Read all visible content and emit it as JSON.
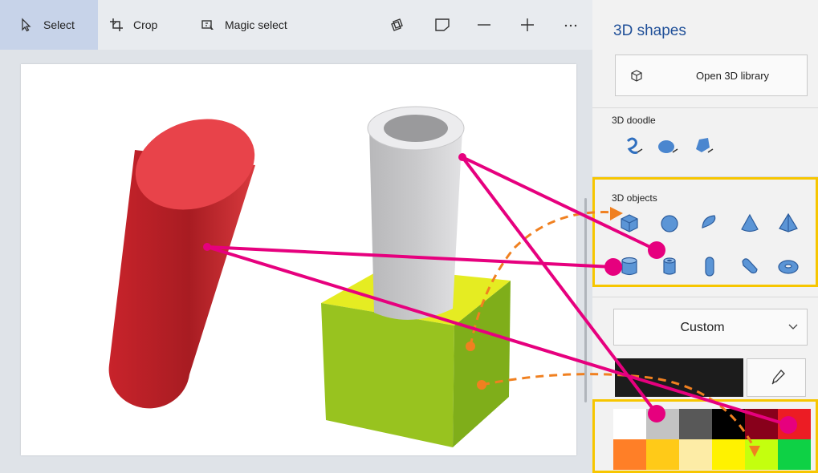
{
  "toolbar": {
    "select_label": "Select",
    "crop_label": "Crop",
    "magic_select_label": "Magic select",
    "icons": [
      "select-arrow-icon",
      "crop-icon",
      "magic-select-icon",
      "view-3d-icon",
      "sticker-icon",
      "zoom-out-icon",
      "zoom-in-icon",
      "more-icon"
    ]
  },
  "panel": {
    "title": "3D shapes",
    "library_button": "Open 3D library",
    "doodle_label": "3D doodle",
    "objects_label": "3D objects",
    "dropdown_value": "Custom"
  },
  "palette": [
    "#ffffff",
    "#c3c3c3",
    "#585858",
    "#000000",
    "#88001b",
    "#ec1c24",
    "#ff7f27",
    "#ffca18",
    "#fdeca6",
    "#fff200",
    "#c4ff0e",
    "#0ed145"
  ],
  "colors": {
    "accent": "#1f4f98",
    "highlight": "#f7c600",
    "callout_line": "#e6007e",
    "callout_dash": "#f08020",
    "select_bg": "#c7d3e9"
  }
}
